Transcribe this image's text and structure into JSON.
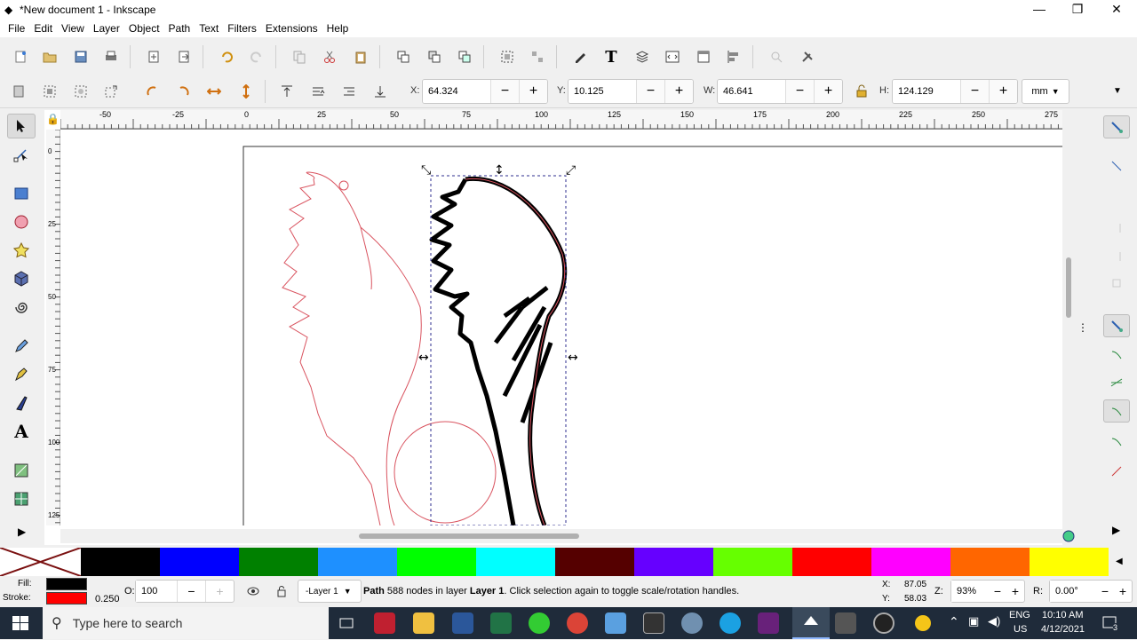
{
  "window": {
    "title": "*New document 1 - Inkscape",
    "minimize": "—",
    "maximize": "❐",
    "close": "✕"
  },
  "menu": [
    "File",
    "Edit",
    "View",
    "Layer",
    "Object",
    "Path",
    "Text",
    "Filters",
    "Extensions",
    "Help"
  ],
  "controls": {
    "x_label": "X:",
    "x_value": "64.324",
    "y_label": "Y:",
    "y_value": "10.125",
    "w_label": "W:",
    "w_value": "46.641",
    "h_label": "H:",
    "h_value": "124.129",
    "unit": "mm",
    "minus": "−",
    "plus": "+"
  },
  "ruler": {
    "h_ticks": [
      "-50",
      "-25",
      "0",
      "25",
      "50",
      "75",
      "100",
      "125",
      "150",
      "175",
      "200",
      "225",
      "250",
      "275"
    ],
    "v_ticks": [
      "0",
      "25",
      "50",
      "75",
      "100",
      "125"
    ]
  },
  "palette": {
    "colors": [
      "#000000",
      "#0000ff",
      "#008000",
      "#1e90ff",
      "#00ff00",
      "#00ffff",
      "#550000",
      "#6600ff",
      "#66ff00",
      "#ff0000",
      "#ff00ff",
      "#ff6600",
      "#ffff00"
    ]
  },
  "status": {
    "fill_label": "Fill:",
    "stroke_label": "Stroke:",
    "stroke_width": "0.250",
    "opacity_label": "O:",
    "opacity_value": "100",
    "layer": "-Layer 1",
    "message_bold": "Path",
    "message_mid": " 588 nodes in layer ",
    "message_layer": "Layer 1",
    "message_end": ". Click selection again to toggle scale/rotation handles.",
    "cx_label": "X:",
    "cx_value": "87.05",
    "cy_label": "Y:",
    "cy_value": "58.03",
    "zoom_label": "Z:",
    "zoom_value": "93%",
    "rot_label": "R:",
    "rot_value": "0.00°"
  },
  "taskbar": {
    "search_placeholder": "Type here to search",
    "lang1": "ENG",
    "lang2": "US",
    "time": "10:10 AM",
    "date": "4/12/2021",
    "notif_count": "3"
  },
  "colors": {
    "fill": "#000000",
    "stroke": "#ff0000",
    "selection": "#2e2e8f"
  }
}
